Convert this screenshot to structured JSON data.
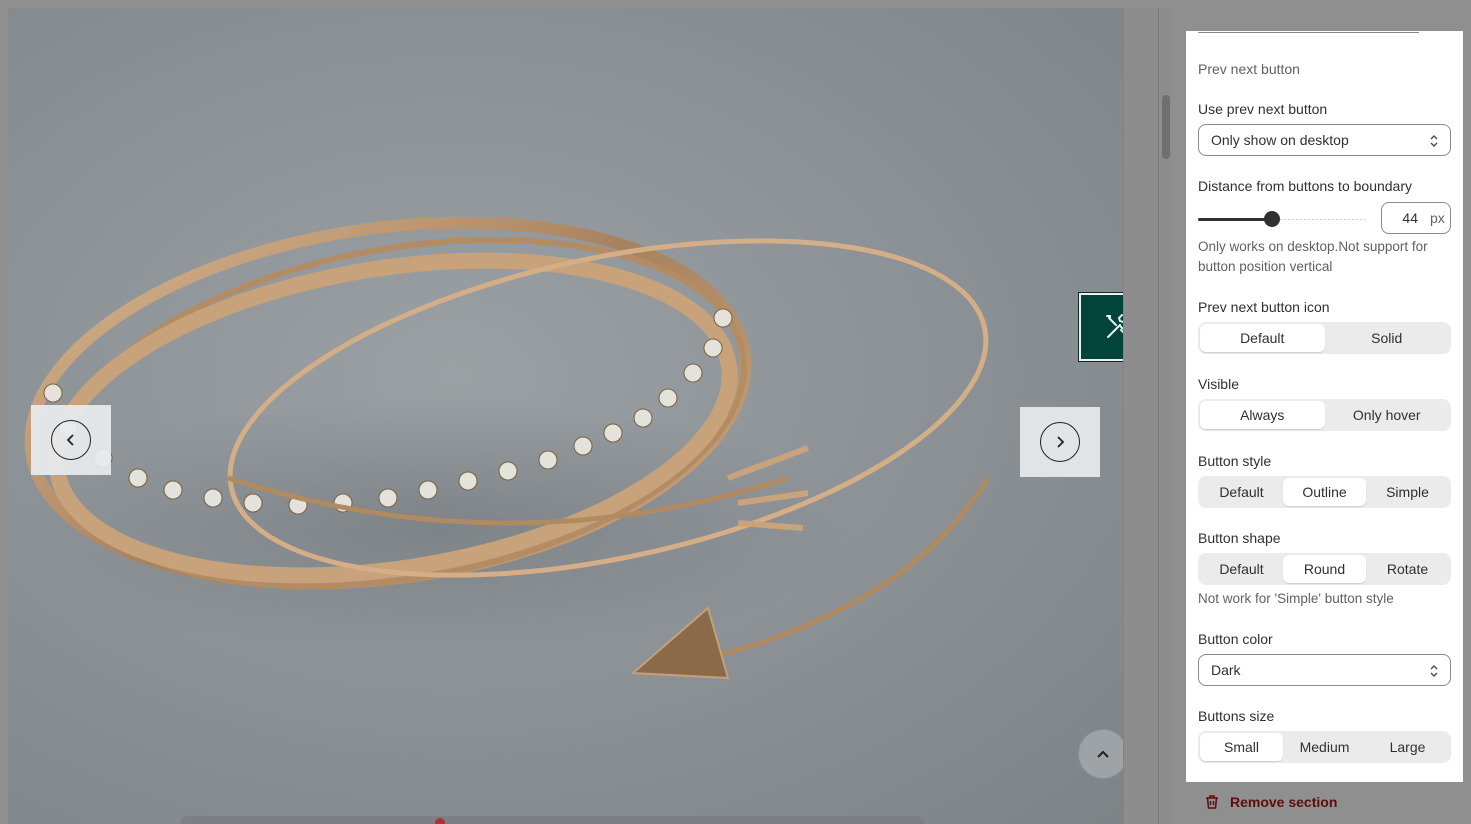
{
  "panel": {
    "section_title": "Prev next button",
    "use_prev_next": {
      "label": "Use prev next button",
      "value": "Only show on desktop"
    },
    "distance": {
      "label": "Distance from buttons to boundary",
      "value": "44",
      "unit": "px",
      "slider_fraction": 0.44,
      "hint": "Only works on desktop.Not support for button position vertical"
    },
    "icon": {
      "label": "Prev next button icon",
      "options": [
        "Default",
        "Solid"
      ],
      "selected": "Default"
    },
    "visible": {
      "label": "Visible",
      "options": [
        "Always",
        "Only hover"
      ],
      "selected": "Always"
    },
    "style": {
      "label": "Button style",
      "options": [
        "Default",
        "Outline",
        "Simple"
      ],
      "selected": "Outline"
    },
    "shape": {
      "label": "Button shape",
      "options": [
        "Default",
        "Round",
        "Rotate"
      ],
      "selected": "Round",
      "hint": "Not work for 'Simple' button style"
    },
    "color": {
      "label": "Button color",
      "value": "Dark"
    },
    "size": {
      "label": "Buttons size",
      "options": [
        "Small",
        "Medium",
        "Large"
      ],
      "selected": "Small"
    }
  },
  "footer": {
    "remove_label": "Remove section"
  },
  "icons": {
    "prev": "chevron-left-icon",
    "next": "chevron-right-icon",
    "tools": "tools-icon",
    "scroll_top": "chevron-up-icon",
    "trash": "trash-icon",
    "select_caret": "select-caret-icon"
  },
  "colors": {
    "tools_bg": "#03443a",
    "remove_text": "#5c0d0d",
    "overlay": "#8f8f8f"
  }
}
